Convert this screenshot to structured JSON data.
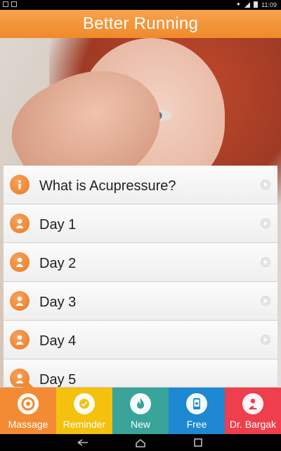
{
  "status_bar": {
    "time": "11:09"
  },
  "header": {
    "title": "Better Running"
  },
  "list": {
    "items": [
      {
        "label": "What is Acupressure?",
        "icon": "info-icon"
      },
      {
        "label": "Day 1",
        "icon": "person-icon"
      },
      {
        "label": "Day 2",
        "icon": "person-icon"
      },
      {
        "label": "Day 3",
        "icon": "person-icon"
      },
      {
        "label": "Day 4",
        "icon": "person-icon"
      },
      {
        "label": "Day 5",
        "icon": "person-icon"
      }
    ]
  },
  "tabs": [
    {
      "label": "Massage",
      "color": "#f28b33",
      "icon": "target-icon",
      "active": true
    },
    {
      "label": "Reminder",
      "color": "#f3c10e",
      "icon": "clock-check-icon",
      "active": false
    },
    {
      "label": "New",
      "color": "#3aa39a",
      "icon": "flame-icon",
      "active": false
    },
    {
      "label": "Free",
      "color": "#1e88d2",
      "icon": "phone-heart-icon",
      "active": false
    },
    {
      "label": "Dr. Bargak",
      "color": "#ef3e4c",
      "icon": "doctor-icon",
      "active": false
    }
  ],
  "colors": {
    "accent": "#f28b33"
  }
}
